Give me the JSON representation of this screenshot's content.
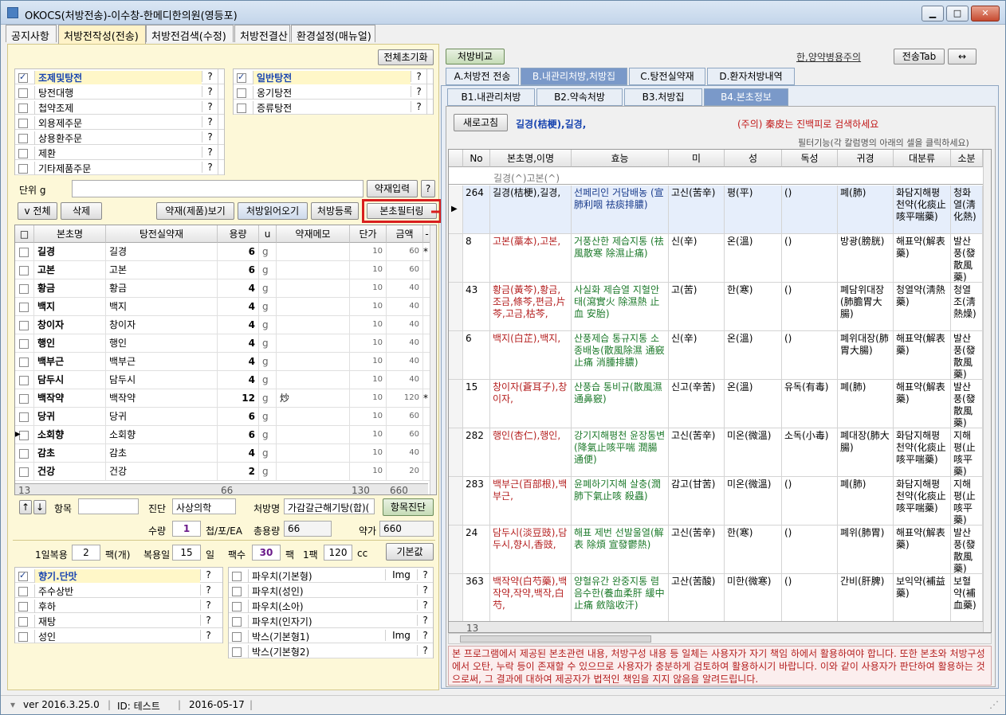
{
  "window": {
    "title": "OKOCS(처방전송)-이수창-한메디한의원(영등포)"
  },
  "menu": [
    "공지사항",
    "처방전작성(전송)",
    "처방전검색(수정)",
    "처방전결산",
    "환경설정(매뉴얼)"
  ],
  "left": {
    "reset_btn": "전체초기화",
    "types_left": [
      {
        "label": "조제및탕전",
        "checked": true
      },
      {
        "label": "탕전대행",
        "checked": false
      },
      {
        "label": "첩약조제",
        "checked": false
      },
      {
        "label": "외용제주문",
        "checked": false
      },
      {
        "label": "상용환주문",
        "checked": false
      },
      {
        "label": "제환",
        "checked": false
      },
      {
        "label": "기타제품주문",
        "checked": false
      }
    ],
    "types_right": [
      {
        "label": "일반탕전",
        "checked": true
      },
      {
        "label": "옹기탕전",
        "checked": false
      },
      {
        "label": "증류탕전",
        "checked": false
      }
    ],
    "q": "?",
    "unit_label": "단위 g",
    "herb_input_btn": "약재입력",
    "q_btn": "?",
    "btn_all": "v 전체",
    "btn_delete": "삭제",
    "btn_view": "약재(제품)보기",
    "btn_read": "처방읽어오기",
    "btn_register": "처방등록",
    "btn_filter": "본초필터링",
    "grid_headers": [
      "□",
      "본초명",
      "탕전실약재",
      "용량",
      "u",
      "약재메모",
      "단가",
      "금액",
      "-"
    ],
    "grid_rows": [
      {
        "name": "길경",
        "herb": "길경",
        "amt": "6",
        "u": "g",
        "memo": "",
        "price": "10",
        "total": "60",
        "mark": "*"
      },
      {
        "name": "고본",
        "herb": "고본",
        "amt": "6",
        "u": "g",
        "memo": "",
        "price": "10",
        "total": "60",
        "mark": ""
      },
      {
        "name": "황금",
        "herb": "황금",
        "amt": "4",
        "u": "g",
        "memo": "",
        "price": "10",
        "total": "40",
        "mark": ""
      },
      {
        "name": "백지",
        "herb": "백지",
        "amt": "4",
        "u": "g",
        "memo": "",
        "price": "10",
        "total": "40",
        "mark": ""
      },
      {
        "name": "창이자",
        "herb": "창이자",
        "amt": "4",
        "u": "g",
        "memo": "",
        "price": "10",
        "total": "40",
        "mark": ""
      },
      {
        "name": "행인",
        "herb": "행인",
        "amt": "4",
        "u": "g",
        "memo": "",
        "price": "10",
        "total": "40",
        "mark": ""
      },
      {
        "name": "백부근",
        "herb": "백부근",
        "amt": "4",
        "u": "g",
        "memo": "",
        "price": "10",
        "total": "40",
        "mark": ""
      },
      {
        "name": "담두시",
        "herb": "담두시",
        "amt": "4",
        "u": "g",
        "memo": "",
        "price": "10",
        "total": "40",
        "mark": ""
      },
      {
        "name": "백작약",
        "herb": "백작약",
        "amt": "12",
        "u": "g",
        "memo": "炒",
        "price": "10",
        "total": "120",
        "mark": "*"
      },
      {
        "name": "당귀",
        "herb": "당귀",
        "amt": "6",
        "u": "g",
        "memo": "",
        "price": "10",
        "total": "60",
        "mark": ""
      },
      {
        "name": "소회향",
        "herb": "소회향",
        "amt": "6",
        "u": "g",
        "memo": "",
        "price": "10",
        "total": "60",
        "mark": ""
      },
      {
        "name": "감초",
        "herb": "감초",
        "amt": "4",
        "u": "g",
        "memo": "",
        "price": "10",
        "total": "40",
        "mark": ""
      },
      {
        "name": "건강",
        "herb": "건강",
        "amt": "2",
        "u": "g",
        "memo": "",
        "price": "10",
        "total": "20",
        "mark": ""
      }
    ],
    "grid_footer": {
      "count": "13",
      "amt": "66",
      "price": "130",
      "total": "660"
    },
    "up_arrow": "↑",
    "down_arrow": "↓",
    "item_label": "항목",
    "diag_label": "진단",
    "diag_value": "사상의학",
    "rx_label": "처방명",
    "rx_value": "가감갈근해기탕(합)(",
    "item_diag_btn": "항목진단",
    "qty_label": "수량",
    "qty_value": "1",
    "unit_text": "첩/포/EA",
    "total_amt_label": "총용량",
    "total_amt_value": "66",
    "price_label": "약가",
    "price_value": "660",
    "daily_label": "1일복용",
    "daily_value": "2",
    "daily_unit": "팩(개)",
    "days_label": "복용일",
    "days_value": "15",
    "days_unit": "일",
    "packs_label": "팩수",
    "packs_value": "30",
    "packs_unit": "팩",
    "perpack_label": "1팩",
    "perpack_value": "120",
    "perpack_unit": "cc",
    "base_btn": "기본값",
    "opt_left": [
      {
        "label": "향기.단맛",
        "checked": true
      },
      {
        "label": "주수상반",
        "checked": false
      },
      {
        "label": "후하",
        "checked": false
      },
      {
        "label": "재탕",
        "checked": false
      },
      {
        "label": "성인",
        "checked": false
      }
    ],
    "opt_right": [
      {
        "label": "파우치(기본형)",
        "img": "Img",
        "checked": false
      },
      {
        "label": "파우치(성인)",
        "img": "",
        "checked": false
      },
      {
        "label": "파우치(소아)",
        "img": "",
        "checked": false
      },
      {
        "label": "파우치(인자기)",
        "img": "",
        "checked": false
      },
      {
        "label": "박스(기본형1)",
        "img": "Img",
        "checked": false
      },
      {
        "label": "박스(기본형2)",
        "img": "",
        "checked": false
      }
    ]
  },
  "right": {
    "compare_btn": "처방비교",
    "caution_link": "한,양약병용주의",
    "send_tab_btn": "전송Tab",
    "swap_btn": "↔",
    "tabs": [
      "A.처방전 전송",
      "B.내관리처방,처방집",
      "C.탕전실약재",
      "D.환자처방내역"
    ],
    "subtabs": [
      "B1.내관리처방",
      "B2.약속처방",
      "B3.처방집",
      "B4.본초정보"
    ],
    "refresh_btn": "새로고침",
    "search_text": "길경(桔梗),길경,",
    "notice": "(주의) 秦皮는 진백피로 검색하세요",
    "filter_hint": "필터기능(각 칼럼명의 아래의 셀을 클릭하세요)",
    "headers": [
      "No",
      "본초명,이명",
      "효능",
      "미",
      "성",
      "독성",
      "귀경",
      "대분류",
      "소분"
    ],
    "filter_row": "길경(^)고본(^)",
    "rows": [
      {
        "no": "264",
        "name": "길경(桔梗),길경,",
        "eff": "선페리인 거담배농 (宣肺利咽 祛痰排膿)",
        "mi": "고신(苦辛)",
        "sung": "평(平)",
        "tox": "()",
        "gw": "폐(肺)",
        "big": "화담지해평천약(化痰止咳平喘藥)",
        "small": "청화열(淸化熱)"
      },
      {
        "no": "8",
        "name": "고본(藁本),고본,",
        "eff": "거풍산한 제습지통 (祛風散寒 除濕止痛)",
        "mi": "신(辛)",
        "sung": "온(溫)",
        "tox": "()",
        "gw": "방광(膀胱)",
        "big": "해표약(解表藥)",
        "small": "발산풍(發散風藥)"
      },
      {
        "no": "43",
        "name": "황금(黃芩),황금,조금,條芩,편금,片芩,고금,枯芩,",
        "eff": "사실화 제습열 지혈안태(瀉實火 除濕熱 止血 安胎)",
        "mi": "고(苦)",
        "sung": "한(寒)",
        "tox": "()",
        "gw": "폐담위대장(肺膽胃大腸)",
        "big": "청열약(淸熱藥)",
        "small": "청열조(淸熱燥)"
      },
      {
        "no": "6",
        "name": "백지(白芷),백지,",
        "eff": "산풍제습 통규지통 소종배농(散風除濕 通竅止痛 消腫排膿)",
        "mi": "신(辛)",
        "sung": "온(溫)",
        "tox": "()",
        "gw": "폐위대장(肺胃大腸)",
        "big": "해표약(解表藥)",
        "small": "발산풍(發散風藥)"
      },
      {
        "no": "15",
        "name": "창이자(蒼耳子),창이자,",
        "eff": "산풍습 통비규(散風濕 通鼻竅)",
        "mi": "신고(辛苦)",
        "sung": "온(溫)",
        "tox": "유독(有毒)",
        "gw": "폐(肺)",
        "big": "해표약(解表藥)",
        "small": "발산풍(發散風藥)"
      },
      {
        "no": "282",
        "name": "행인(杏仁),행인,",
        "eff": "강기지해평천 윤장통변(降氣止咳平喘 潤腸通便)",
        "mi": "고신(苦辛)",
        "sung": "미온(微溫)",
        "tox": "소독(小毒)",
        "gw": "폐대장(肺大腸)",
        "big": "화담지해평천약(化痰止咳平喘藥)",
        "small": "지해평(止咳平藥)"
      },
      {
        "no": "283",
        "name": "백부근(百部根),백부근,",
        "eff": "윤폐하기지해 살충(潤肺下氣止咳 殺蟲)",
        "mi": "감고(甘苦)",
        "sung": "미온(微溫)",
        "tox": "()",
        "gw": "폐(肺)",
        "big": "화담지해평천약(化痰止咳平喘藥)",
        "small": "지해평(止咳平藥)"
      },
      {
        "no": "24",
        "name": "담두시(淡豆豉),담두시,향시,香豉,",
        "eff": "해표 제번 선발울열(解表 除煩 宣發鬱熱)",
        "mi": "고신(苦辛)",
        "sung": "한(寒)",
        "tox": "()",
        "gw": "폐위(肺胃)",
        "big": "해표약(解表藥)",
        "small": "발산풍(發散風藥)"
      },
      {
        "no": "363",
        "name": "백작약(白芍藥),백작약,작약,백작,白芍,",
        "eff": "양혈유간 완중지통 렴음수한(養血柔肝 緩中止痛 斂陰收汗)",
        "mi": "고산(苦酸)",
        "sung": "미한(微寒)",
        "tox": "()",
        "gw": "간비(肝脾)",
        "big": "보익약(補益藥)",
        "small": "보혈약(補血藥)"
      }
    ],
    "footer_count": "13",
    "disclaimer": "본 프로그램에서 제공된 본초관련 내용, 처방구성 내용 등 일체는 사용자가 자기 책임 하에서 활용하여야 합니다. 또한 본초와 처방구성에서 오탄, 누락 등이 존재할 수 있으므로 사용자가 충분하게 검토하여 활용하시기 바랍니다. 이와 같이 사용자가 판단하여 활용하는 것으로써, 그 결과에 대하여 제공자가 법적인 책임을 지지 않음을 알려드립니다."
  },
  "status": {
    "version": "ver 2016.3.25.0",
    "id": "ID: 테스트",
    "date": "2016-05-17"
  }
}
